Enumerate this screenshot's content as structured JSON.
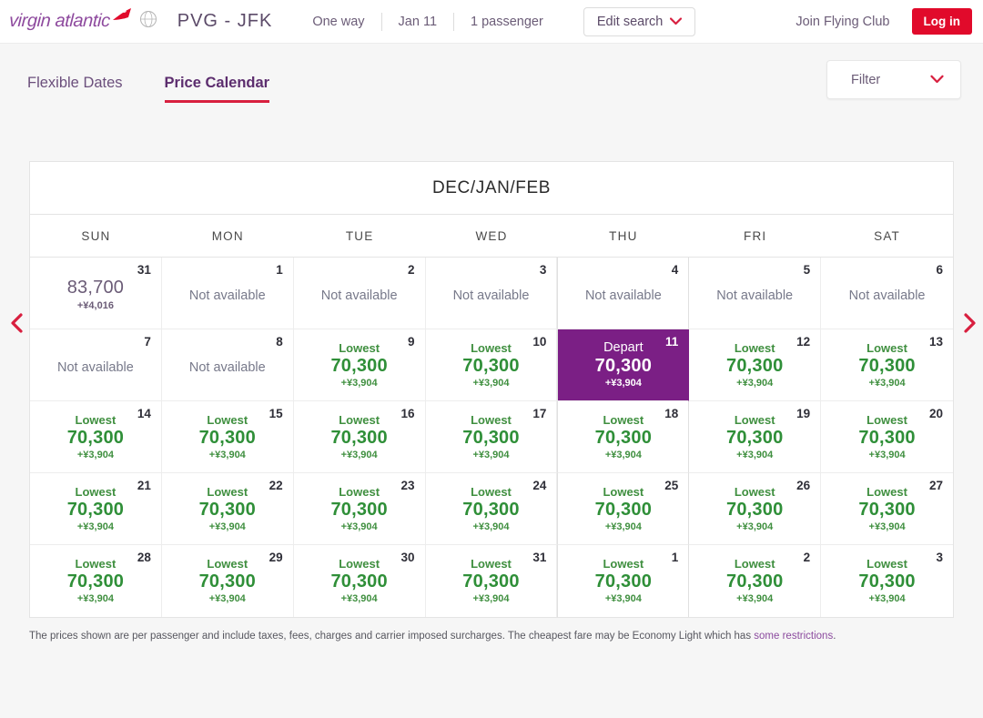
{
  "header": {
    "logo_text": "virgin atlantic",
    "logo_icon": "virgin-flag-icon",
    "roundel_icon": "globe-roundel-icon",
    "route": "PVG - JFK",
    "crumbs": [
      "One way",
      "Jan 11",
      "1 passenger"
    ],
    "edit_search_label": "Edit search",
    "edit_search_icon": "chevron-down-icon",
    "join_label": "Join Flying Club",
    "login_label": "Log in",
    "login_color": "#e10a2b"
  },
  "tabs": [
    {
      "label": "Flexible Dates",
      "active": false
    },
    {
      "label": "Price Calendar",
      "active": true
    }
  ],
  "filter": {
    "label": "Filter",
    "icon": "chevron-down-icon"
  },
  "nav": {
    "prev_icon": "chevron-left-icon",
    "next_icon": "chevron-right-icon"
  },
  "calendar": {
    "title": "DEC/JAN/FEB",
    "dow": [
      "SUN",
      "MON",
      "TUE",
      "WED",
      "THU",
      "FRI",
      "SAT"
    ],
    "accent_selected": "#7b1f85",
    "accent_price": "#2f8f38",
    "weeks": [
      [
        {
          "day": "31",
          "type": "price-plain",
          "price": "83,700",
          "tax": "+¥4,016"
        },
        {
          "day": "1",
          "type": "na",
          "text": "Not available"
        },
        {
          "day": "2",
          "type": "na",
          "text": "Not available"
        },
        {
          "day": "3",
          "type": "na",
          "text": "Not available"
        },
        {
          "day": "4",
          "type": "na",
          "text": "Not available"
        },
        {
          "day": "5",
          "type": "na",
          "text": "Not available"
        },
        {
          "day": "6",
          "type": "na",
          "text": "Not available"
        }
      ],
      [
        {
          "day": "7",
          "type": "na",
          "text": "Not available"
        },
        {
          "day": "8",
          "type": "na",
          "text": "Not available"
        },
        {
          "day": "9",
          "type": "lowest",
          "label": "Lowest",
          "price": "70,300",
          "tax": "+¥3,904"
        },
        {
          "day": "10",
          "type": "lowest",
          "label": "Lowest",
          "price": "70,300",
          "tax": "+¥3,904"
        },
        {
          "day": "11",
          "type": "depart",
          "label": "Depart",
          "price": "70,300",
          "tax": "+¥3,904"
        },
        {
          "day": "12",
          "type": "lowest",
          "label": "Lowest",
          "price": "70,300",
          "tax": "+¥3,904"
        },
        {
          "day": "13",
          "type": "lowest",
          "label": "Lowest",
          "price": "70,300",
          "tax": "+¥3,904"
        }
      ],
      [
        {
          "day": "14",
          "type": "lowest",
          "label": "Lowest",
          "price": "70,300",
          "tax": "+¥3,904"
        },
        {
          "day": "15",
          "type": "lowest",
          "label": "Lowest",
          "price": "70,300",
          "tax": "+¥3,904"
        },
        {
          "day": "16",
          "type": "lowest",
          "label": "Lowest",
          "price": "70,300",
          "tax": "+¥3,904"
        },
        {
          "day": "17",
          "type": "lowest",
          "label": "Lowest",
          "price": "70,300",
          "tax": "+¥3,904"
        },
        {
          "day": "18",
          "type": "lowest",
          "label": "Lowest",
          "price": "70,300",
          "tax": "+¥3,904"
        },
        {
          "day": "19",
          "type": "lowest",
          "label": "Lowest",
          "price": "70,300",
          "tax": "+¥3,904"
        },
        {
          "day": "20",
          "type": "lowest",
          "label": "Lowest",
          "price": "70,300",
          "tax": "+¥3,904"
        }
      ],
      [
        {
          "day": "21",
          "type": "lowest",
          "label": "Lowest",
          "price": "70,300",
          "tax": "+¥3,904"
        },
        {
          "day": "22",
          "type": "lowest",
          "label": "Lowest",
          "price": "70,300",
          "tax": "+¥3,904"
        },
        {
          "day": "23",
          "type": "lowest",
          "label": "Lowest",
          "price": "70,300",
          "tax": "+¥3,904"
        },
        {
          "day": "24",
          "type": "lowest",
          "label": "Lowest",
          "price": "70,300",
          "tax": "+¥3,904"
        },
        {
          "day": "25",
          "type": "lowest",
          "label": "Lowest",
          "price": "70,300",
          "tax": "+¥3,904"
        },
        {
          "day": "26",
          "type": "lowest",
          "label": "Lowest",
          "price": "70,300",
          "tax": "+¥3,904"
        },
        {
          "day": "27",
          "type": "lowest",
          "label": "Lowest",
          "price": "70,300",
          "tax": "+¥3,904"
        }
      ],
      [
        {
          "day": "28",
          "type": "lowest",
          "label": "Lowest",
          "price": "70,300",
          "tax": "+¥3,904"
        },
        {
          "day": "29",
          "type": "lowest",
          "label": "Lowest",
          "price": "70,300",
          "tax": "+¥3,904"
        },
        {
          "day": "30",
          "type": "lowest",
          "label": "Lowest",
          "price": "70,300",
          "tax": "+¥3,904"
        },
        {
          "day": "31",
          "type": "lowest",
          "label": "Lowest",
          "price": "70,300",
          "tax": "+¥3,904"
        },
        {
          "day": "1",
          "type": "lowest",
          "label": "Lowest",
          "price": "70,300",
          "tax": "+¥3,904"
        },
        {
          "day": "2",
          "type": "lowest",
          "label": "Lowest",
          "price": "70,300",
          "tax": "+¥3,904"
        },
        {
          "day": "3",
          "type": "lowest",
          "label": "Lowest",
          "price": "70,300",
          "tax": "+¥3,904"
        }
      ]
    ]
  },
  "footer": {
    "text": "The prices shown are per passenger and include taxes, fees, charges and carrier imposed surcharges. The cheapest fare may be Economy Light which has ",
    "link": "some restrictions",
    "tail": "."
  }
}
